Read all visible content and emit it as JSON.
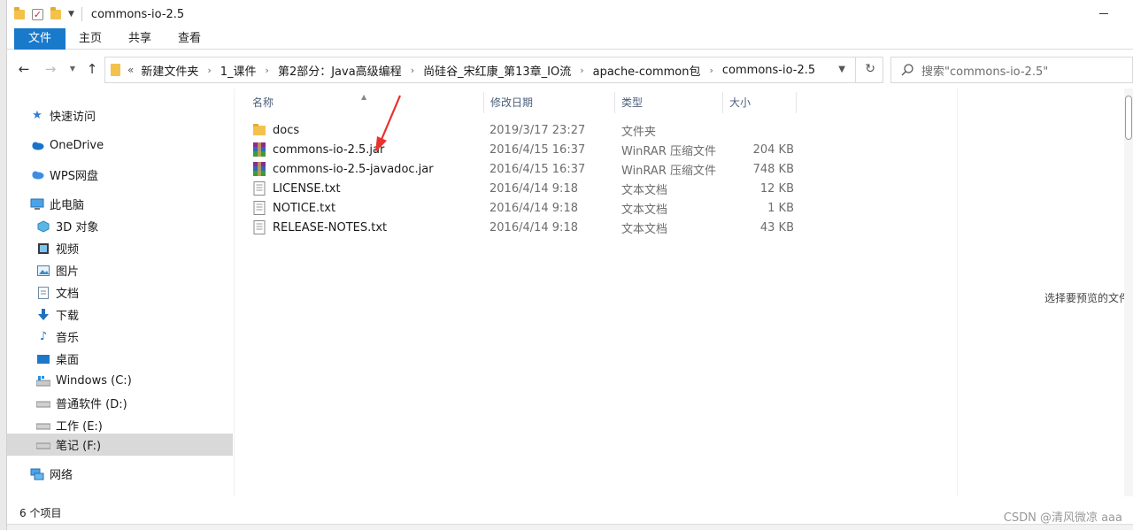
{
  "window": {
    "title": "commons-io-2.5"
  },
  "ribbon": {
    "tabs": [
      "文件",
      "主页",
      "共享",
      "查看"
    ]
  },
  "address": {
    "breadcrumb": [
      "新建文件夹",
      "1_课件",
      "第2部分：Java高级编程",
      "尚硅谷_宋红康_第13章_IO流",
      "apache-common包",
      "commons-io-2.5"
    ],
    "lead": "«"
  },
  "search": {
    "placeholder": "搜索\"commons-io-2.5\""
  },
  "nav_pane": {
    "items": [
      {
        "label": "快速访问",
        "icon": "star-icon"
      },
      {
        "label": "OneDrive",
        "icon": "cloud-icon"
      },
      {
        "label": "WPS网盘",
        "icon": "wps-cloud-icon"
      },
      {
        "label": "此电脑",
        "icon": "computer-icon"
      },
      {
        "label": "3D 对象",
        "icon": "3d-objects-icon"
      },
      {
        "label": "视频",
        "icon": "video-icon"
      },
      {
        "label": "图片",
        "icon": "picture-icon"
      },
      {
        "label": "文档",
        "icon": "document-icon"
      },
      {
        "label": "下载",
        "icon": "download-icon"
      },
      {
        "label": "音乐",
        "icon": "music-icon"
      },
      {
        "label": "桌面",
        "icon": "desktop-icon"
      },
      {
        "label": "Windows (C:)",
        "icon": "windows-drive-icon"
      },
      {
        "label": "普通软件 (D:)",
        "icon": "drive-icon"
      },
      {
        "label": "工作 (E:)",
        "icon": "drive-icon"
      },
      {
        "label": "笔记 (F:)",
        "icon": "drive-icon"
      },
      {
        "label": "网络",
        "icon": "network-icon"
      }
    ]
  },
  "file_list": {
    "columns": [
      "名称",
      "修改日期",
      "类型",
      "大小"
    ],
    "rows": [
      {
        "name": "docs",
        "date": "2019/3/17 23:27",
        "type": "文件夹",
        "size": "",
        "icon": "folder-icon"
      },
      {
        "name": "commons-io-2.5.jar",
        "date": "2016/4/15 16:37",
        "type": "WinRAR 压缩文件",
        "size": "204 KB",
        "icon": "winrar-icon"
      },
      {
        "name": "commons-io-2.5-javadoc.jar",
        "date": "2016/4/15 16:37",
        "type": "WinRAR 压缩文件",
        "size": "748 KB",
        "icon": "winrar-icon"
      },
      {
        "name": "LICENSE.txt",
        "date": "2016/4/14 9:18",
        "type": "文本文档",
        "size": "12 KB",
        "icon": "text-file-icon"
      },
      {
        "name": "NOTICE.txt",
        "date": "2016/4/14 9:18",
        "type": "文本文档",
        "size": "1 KB",
        "icon": "text-file-icon"
      },
      {
        "name": "RELEASE-NOTES.txt",
        "date": "2016/4/14 9:18",
        "type": "文本文档",
        "size": "43 KB",
        "icon": "text-file-icon"
      }
    ]
  },
  "preview": {
    "text": "选择要预览的文件。"
  },
  "status": {
    "item_count": "6 个项目"
  },
  "watermark": "CSDN @清风微凉 aaa",
  "colors": {
    "accent": "#1979ca",
    "folder": "#f3c24d",
    "selected_row": "#d9d9d9",
    "annotation": "#e8322b"
  }
}
